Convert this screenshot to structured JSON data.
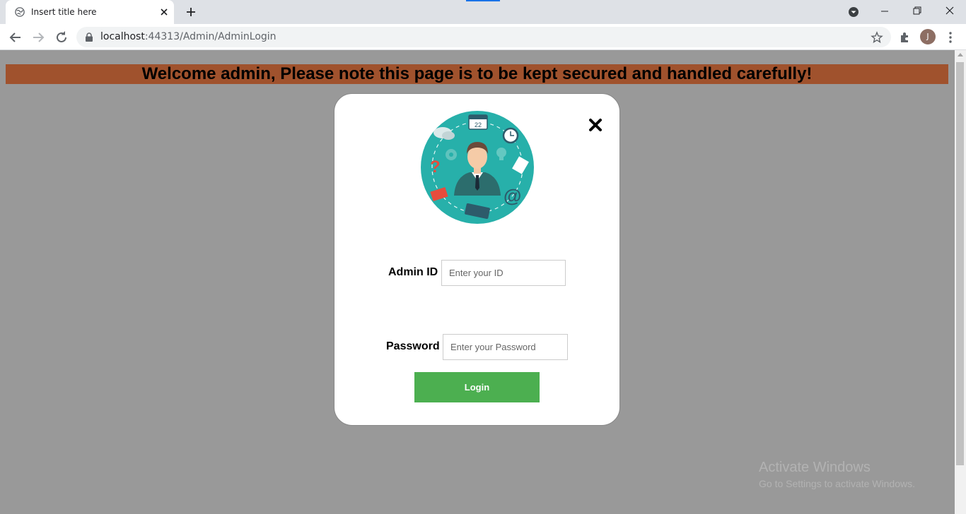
{
  "browser": {
    "tab_title": "Insert title here",
    "url_host": "localhost",
    "url_path": ":44313/Admin/AdminLogin",
    "profile_initial": "J"
  },
  "page": {
    "banner_text": "Welcome admin, Please note this page is to be kept secured and handled carefully!",
    "background_color": "#999999",
    "banner_color": "#a0522d"
  },
  "login_form": {
    "admin_id_label": "Admin ID",
    "admin_id_placeholder": "Enter your ID",
    "admin_id_value": "",
    "password_label": "Password",
    "password_placeholder": "Enter your Password",
    "password_value": "",
    "login_button": "Login",
    "button_color": "#4caf50",
    "illustration_icon": "admin-user-avatar",
    "calendar_day": "22"
  },
  "watermark": {
    "title": "Activate Windows",
    "subtitle": "Go to Settings to activate Windows."
  }
}
